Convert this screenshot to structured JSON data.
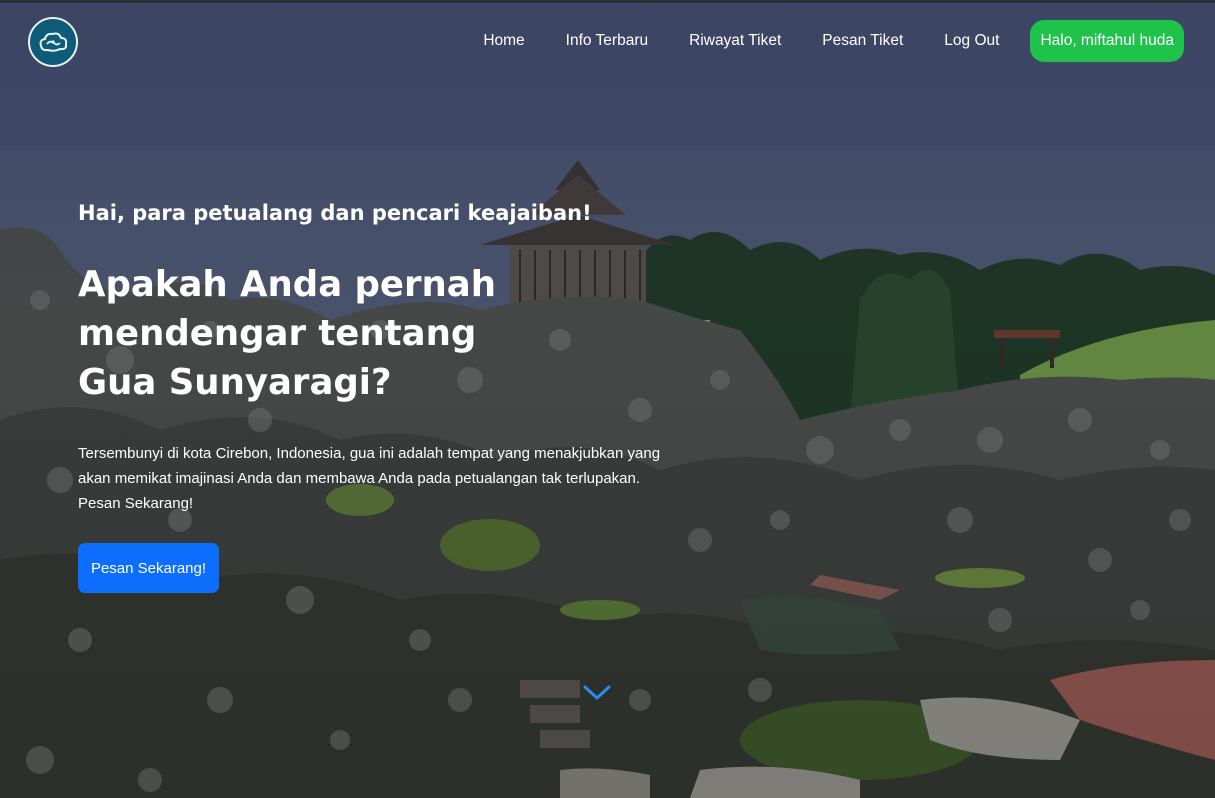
{
  "nav": {
    "links": [
      "Home",
      "Info Terbaru",
      "Riwayat Tiket",
      "Pesan Tiket",
      "Log Out"
    ],
    "user_greeting": "Halo, miftahul huda"
  },
  "hero": {
    "greeting": "Hai, para petualang dan pencari keajaiban!",
    "headline": "Apakah Anda pernah mendengar tentang Gua Sunyaragi?",
    "description": "Tersembunyi di kota Cirebon, Indonesia, gua ini adalah tempat yang menakjubkan yang akan memikat imajinasi Anda dan membawa Anda pada petualangan tak terlupakan. Pesan Sekarang!",
    "cta_label": "Pesan Sekarang!"
  },
  "colors": {
    "cta": "#0d6efd",
    "user_pill": "#1fc24a",
    "chevron": "#2d8cf0"
  },
  "icons": {
    "logo": "cloud-logo-icon",
    "scroll": "chevron-down-icon"
  }
}
